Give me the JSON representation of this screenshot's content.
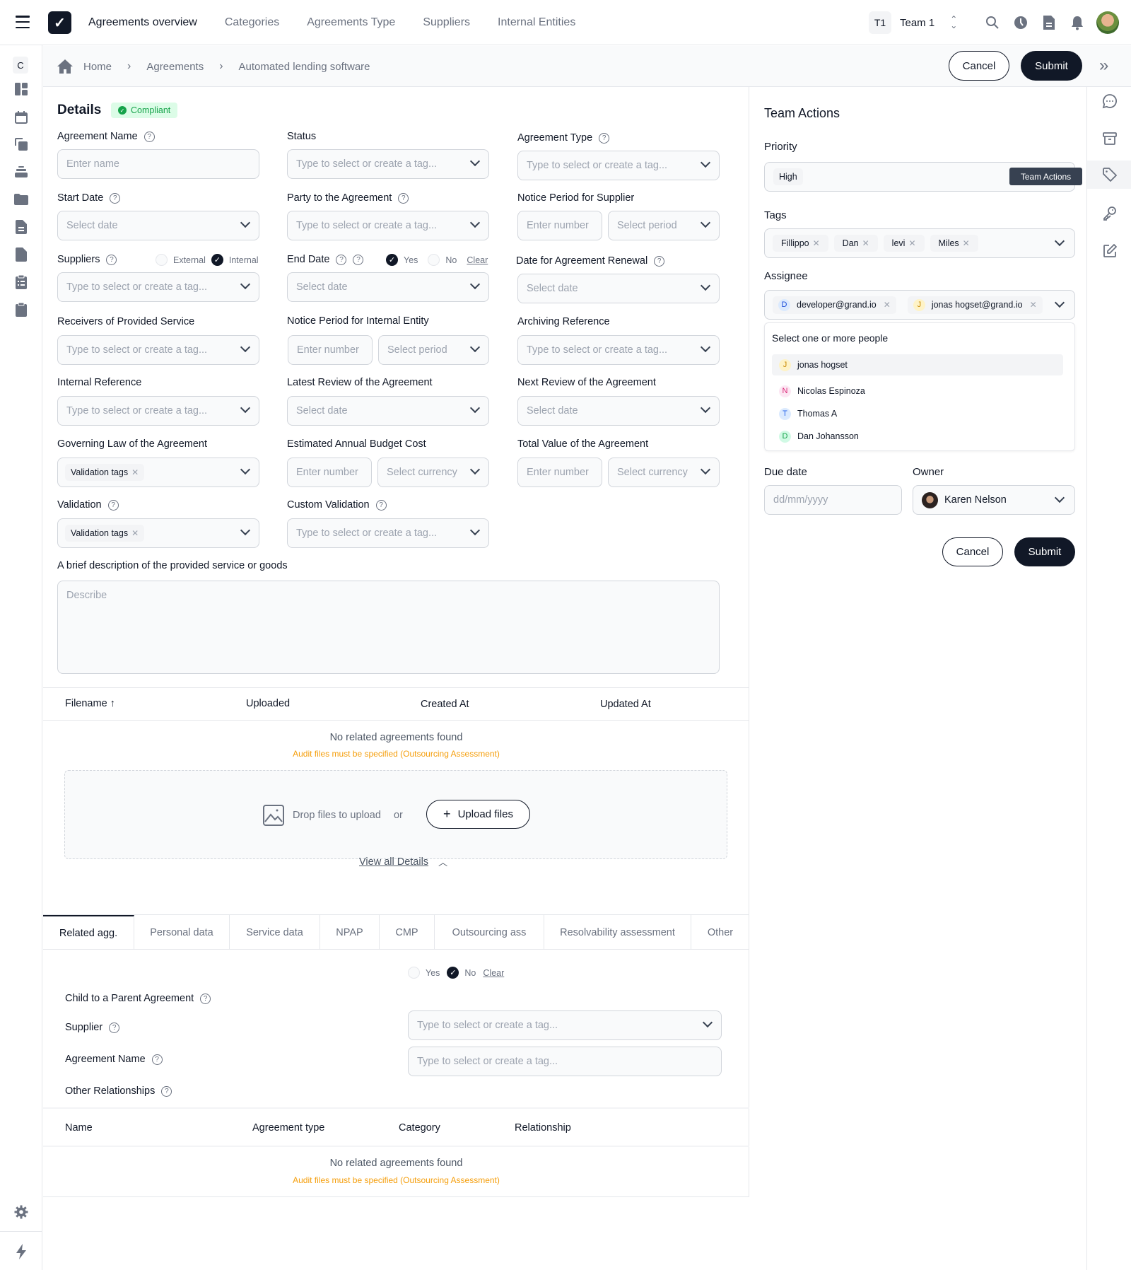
{
  "topbar": {
    "title": "Agreements overview",
    "nav": [
      "Categories",
      "Agreements Type",
      "Suppliers",
      "Internal Entities"
    ],
    "team_badge": "T1",
    "team_name": "Team 1"
  },
  "sidebar": {
    "badge": "C"
  },
  "breadcrumb": [
    "Home",
    "Agreements",
    "Automated lending software"
  ],
  "header_actions": {
    "cancel": "Cancel",
    "submit": "Submit"
  },
  "details": {
    "title": "Details",
    "status_badge": "Compliant",
    "colors": {
      "compliant_bg": "#dcfce7",
      "compliant_text": "#16a34a",
      "warning": "#f59e0b",
      "primary": "#111827"
    },
    "fields": {
      "agreement_name": {
        "label": "Agreement Name",
        "placeholder": "Enter name"
      },
      "status": {
        "label": "Status",
        "placeholder": "Type to select or create a tag..."
      },
      "agreement_type": {
        "label": "Agreement Type",
        "placeholder": "Type to select or create a tag..."
      },
      "start_date": {
        "label": "Start Date",
        "placeholder": "Select date"
      },
      "party": {
        "label": "Party to the Agreement",
        "placeholder": "Type to select or create a tag..."
      },
      "notice_supplier": {
        "label": "Notice Period for Supplier",
        "number_placeholder": "Enter number",
        "period_placeholder": "Select period"
      },
      "suppliers": {
        "label": "Suppliers",
        "placeholder": "Type to select or create a tag...",
        "option_external": "External",
        "option_internal": "Internal",
        "selected": "Internal"
      },
      "end_date": {
        "label": "End Date",
        "placeholder": "Select date",
        "option_yes": "Yes",
        "option_no": "No",
        "clear": "Clear",
        "selected": "Yes"
      },
      "renewal_date": {
        "label": "Date for Agreement Renewal",
        "placeholder": "Select date"
      },
      "receivers": {
        "label": "Receivers of Provided Service",
        "placeholder": "Type to select or create a tag..."
      },
      "notice_internal": {
        "label": "Notice Period for Internal Entity",
        "number_placeholder": "Enter number",
        "period_placeholder": "Select period"
      },
      "archiving_ref": {
        "label": "Archiving Reference",
        "placeholder": "Type to select or create a tag..."
      },
      "internal_ref": {
        "label": "Internal Reference",
        "placeholder": "Type to select or create a tag..."
      },
      "latest_review": {
        "label": "Latest Review of the Agreement",
        "placeholder": "Select date"
      },
      "next_review": {
        "label": "Next Review of the Agreement",
        "placeholder": "Select date"
      },
      "governing_law": {
        "label": "Governing Law of the Agreement",
        "chip": "Validation tags"
      },
      "budget_cost": {
        "label": "Estimated Annual Budget Cost",
        "number_placeholder": "Enter number",
        "currency_placeholder": "Select currency"
      },
      "total_value": {
        "label": "Total Value of the Agreement",
        "number_placeholder": "Enter number",
        "currency_placeholder": "Select currency"
      },
      "validation": {
        "label": "Validation",
        "chip": "Validation tags"
      },
      "custom_validation": {
        "label": "Custom Validation",
        "placeholder": "Type to select or create a tag..."
      },
      "description": {
        "label": "A brief description of the provided service or goods",
        "placeholder": "Describe"
      }
    }
  },
  "files": {
    "columns": [
      "Filename",
      "Uploaded",
      "Created At",
      "Updated At"
    ],
    "empty": "No related agreements found",
    "warning": "Audit files must be specified (Outsourcing Assessment)",
    "drop_text": "Drop files to upload",
    "or": "or",
    "upload_button": "Upload files",
    "view_all": "View all Details"
  },
  "tabs": [
    "Related agg.",
    "Personal data",
    "Service data",
    "NPAP",
    "CMP",
    "Outsourcing ass",
    "Resolvability assessment",
    "Other"
  ],
  "active_tab": "Related agg.",
  "related": {
    "child_label": "Child to a Parent Agreement",
    "option_yes": "Yes",
    "option_no": "No",
    "clear": "Clear",
    "selected": "No",
    "supplier_label": "Supplier",
    "supplier_placeholder": "Type to select or create a tag...",
    "agreement_name_label": "Agreement Name",
    "agreement_name_placeholder": "Type to select or create a tag...",
    "other_label": "Other Relationships",
    "columns": [
      "Name",
      "Agreement type",
      "Category",
      "Relationship"
    ],
    "empty": "No related agreements found",
    "warning": "Audit files must be specified (Outsourcing Assessment)"
  },
  "team_actions": {
    "title": "Team Actions",
    "priority_label": "Priority",
    "priority_value": "High",
    "tooltip": "Team Actions",
    "tags_label": "Tags",
    "tags": [
      "Fillippo",
      "Dan",
      "levi",
      "Miles"
    ],
    "assignee_label": "Assignee",
    "assignees": [
      {
        "initial": "D",
        "email": "developer@grand.io"
      },
      {
        "initial": "J",
        "email": "jonas hogset@grand.io"
      }
    ],
    "dropdown_title": "Select one or more people",
    "people": [
      {
        "initial": "J",
        "name": "jonas hogset",
        "color": "#ca8a04",
        "bg": "#fef3c7"
      },
      {
        "initial": "N",
        "name": "Nicolas Espinoza",
        "color": "#db2777",
        "bg": "#fce7f3"
      },
      {
        "initial": "T",
        "name": "Thomas A",
        "color": "#2563eb",
        "bg": "#dbeafe"
      },
      {
        "initial": "D",
        "name": "Dan Johansson",
        "color": "#16a34a",
        "bg": "#d1fae5"
      }
    ],
    "due_date_label": "Due date",
    "due_date_placeholder": "dd/mm/yyyy",
    "owner_label": "Owner",
    "owner_value": "Karen Nelson",
    "cancel": "Cancel",
    "submit": "Submit"
  }
}
